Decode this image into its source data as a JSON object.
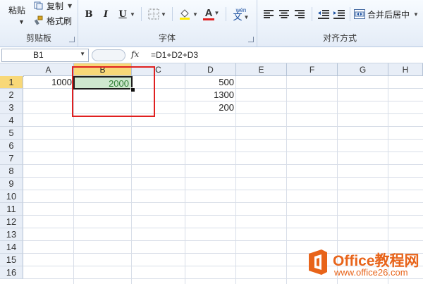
{
  "ribbon": {
    "clipboard": {
      "label": "剪贴板",
      "paste": "粘贴",
      "copy": "复制",
      "format_painter": "格式刷"
    },
    "font": {
      "label": "字体",
      "bold": "B",
      "italic": "I",
      "underline": "U",
      "font_color": "A",
      "wen": "wén",
      "wen2": "文"
    },
    "alignment": {
      "label": "对齐方式",
      "merge_center": "合并后居中"
    }
  },
  "formula_bar": {
    "name_box": "B1",
    "fx": "fx",
    "formula": "=D1+D2+D3"
  },
  "grid": {
    "columns": [
      "A",
      "B",
      "C",
      "D",
      "E",
      "F",
      "G",
      "H"
    ],
    "rows": [
      "1",
      "2",
      "3",
      "4",
      "5",
      "6",
      "7",
      "8",
      "9",
      "10",
      "11",
      "12",
      "13",
      "14",
      "15",
      "16"
    ],
    "cells": {
      "A1": "1000",
      "B1": "2000",
      "D1": "500",
      "D2": "1300",
      "D3": "200"
    }
  },
  "watermark": {
    "brand": "Office教程网",
    "url": "www.office26.com"
  },
  "colors": {
    "accent_select": "#f8d878",
    "active_fill": "#cfe8cf",
    "highlight_box": "#e02020",
    "watermark": "#e8641a"
  }
}
